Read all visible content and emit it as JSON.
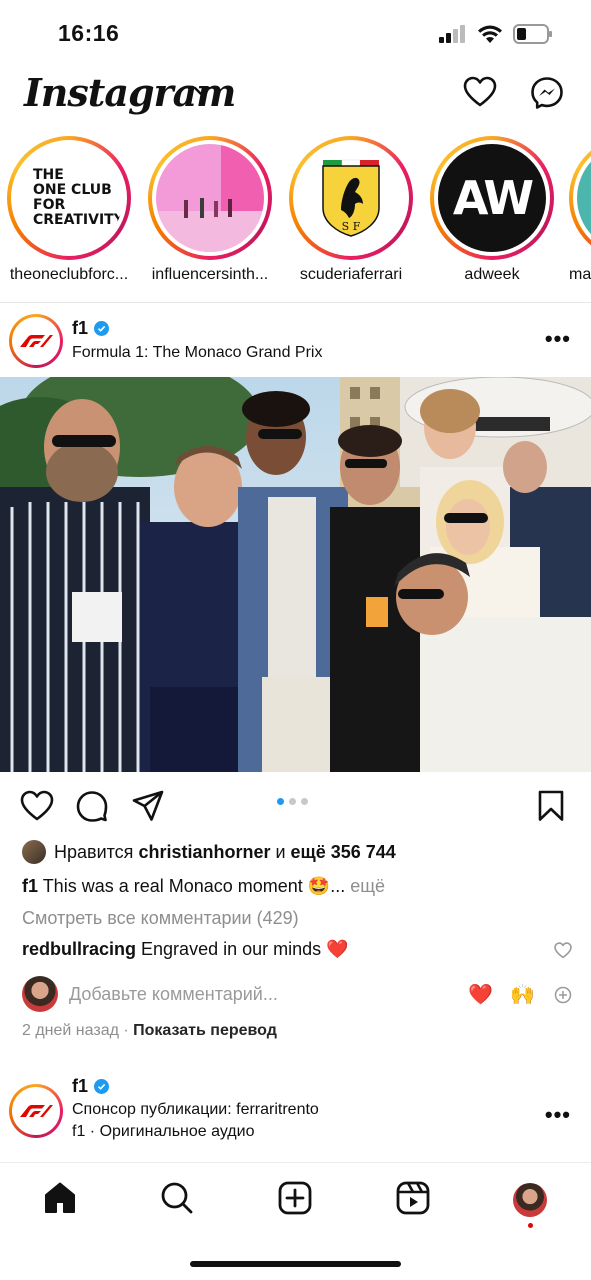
{
  "status_bar": {
    "time": "16:16"
  },
  "header": {
    "logo": "Instagram"
  },
  "stories": [
    {
      "name": "theoneclubforc...",
      "logo_text": [
        "THE",
        "ONE CLUB",
        "FOR",
        "CREATIVITY"
      ]
    },
    {
      "name": "influencersinth..."
    },
    {
      "name": "scuderiaferrari",
      "logo_text": "S F"
    },
    {
      "name": "adweek",
      "logo_text": "AW"
    },
    {
      "name": "ma"
    }
  ],
  "post": {
    "username": "f1",
    "subtitle": "Formula 1: The Monaco Grand Prix",
    "likes": {
      "prefix": "Нравится ",
      "user": "christianhorner",
      "middle": " и ",
      "count": "ещё 356 744"
    },
    "caption": {
      "user": "f1",
      "text": " This was a real Monaco moment ",
      "emoji": "🤩",
      "ellipsis": "...",
      "more": " ещё"
    },
    "view_all": "Смотреть все комментарии (429)",
    "comment": {
      "user": "redbullracing",
      "text": " Engraved in our minds ",
      "emoji": "❤️"
    },
    "add_comment_placeholder": "Добавьте комментарий...",
    "quick_emojis": [
      "❤️",
      "🙌"
    ],
    "time_ago": "2 дней назад",
    "translate": "Показать перевод",
    "carousel": {
      "count": 3,
      "active": 1
    }
  },
  "post2": {
    "username": "f1",
    "sponsor_prefix": "Спонсор публикации: ",
    "sponsor": "ferraritrento",
    "audio": "f1 · Оригинальное аудио"
  },
  "colors": {
    "accent": "#1d9bf0",
    "f1_red": "#e10600",
    "ferrari_yellow": "#f6d23b"
  }
}
